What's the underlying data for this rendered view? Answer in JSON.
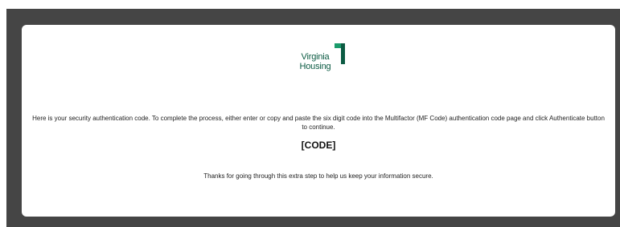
{
  "brand": {
    "name_line1": "Virginia",
    "name_line2": "Housing",
    "color": "#0c5b43",
    "accent": "#1a9b6b"
  },
  "frame": {
    "background": "#454545"
  },
  "email": {
    "message": "Here is your security authentication code. To complete the process, either enter or copy and paste the six digit code into the Multifactor (MF Code) authentication code page and click Authenticate button to continue.",
    "code": "[CODE]",
    "thanks": "Thanks for going through this extra step to help us keep your information secure."
  }
}
